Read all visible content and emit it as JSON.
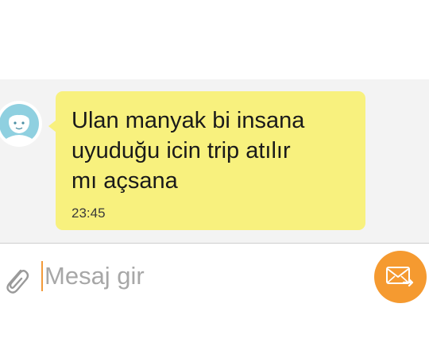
{
  "conversation": {
    "incoming_message": {
      "text": "Ulan manyak bi insana\nuyuduğu icin trip atılır\nmı açsana",
      "time": "23:45"
    }
  },
  "composer": {
    "placeholder": "Mesaj gir",
    "value": ""
  },
  "icons": {
    "avatar": "default-contact-avatar",
    "attach": "paperclip-icon",
    "send": "envelope-send-icon"
  },
  "colors": {
    "bubble": "#f8f17e",
    "accent": "#f59a30",
    "avatar": "#8fd0e0"
  }
}
